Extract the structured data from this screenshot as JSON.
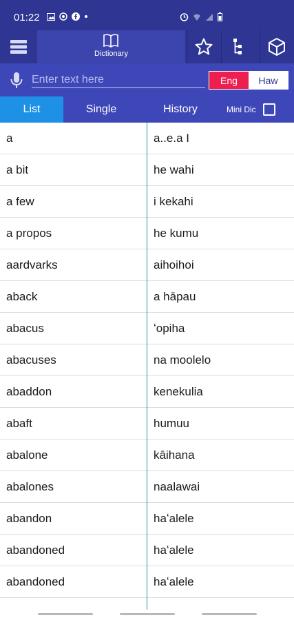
{
  "status_bar": {
    "time": "01:22",
    "icons": [
      "gallery-icon",
      "whatsapp-icon",
      "facebook-icon",
      "dot-icon",
      "alarm-icon",
      "wifi-icon",
      "signal-icon",
      "battery-icon"
    ]
  },
  "toolbar": {
    "dictionary_label": "Dictionary",
    "icons": [
      "menu-icon",
      "book-icon",
      "star-icon",
      "tree-icon",
      "cube-icon"
    ]
  },
  "search": {
    "placeholder": "Enter text here",
    "value": ""
  },
  "language": {
    "eng_label": "Eng",
    "haw_label": "Haw",
    "selected": "Eng"
  },
  "tabs": [
    {
      "label": "List",
      "active": true
    },
    {
      "label": "Single",
      "active": false
    },
    {
      "label": "History",
      "active": false
    }
  ],
  "mini_dic": {
    "label": "Mini Dic",
    "checked": false
  },
  "entries": [
    {
      "en": "a",
      "haw": "a..e.a I"
    },
    {
      "en": "a bit",
      "haw": "he wahi"
    },
    {
      "en": "a few",
      "haw": "i kekahi"
    },
    {
      "en": "a propos",
      "haw": "he kumu"
    },
    {
      "en": "aardvarks",
      "haw": "aihoihoi"
    },
    {
      "en": "aback",
      "haw": "a hāpau"
    },
    {
      "en": "abacus",
      "haw": "ʻopiha"
    },
    {
      "en": "abacuses",
      "haw": "na moolelo"
    },
    {
      "en": "abaddon",
      "haw": "kenekulia"
    },
    {
      "en": "abaft",
      "haw": "humuu"
    },
    {
      "en": "abalone",
      "haw": "kāihana"
    },
    {
      "en": "abalones",
      "haw": "naalawai"
    },
    {
      "en": "abandon",
      "haw": "haʻalele"
    },
    {
      "en": "abandoned",
      "haw": "haʻalele"
    },
    {
      "en": "abandoned",
      "haw": "haʻalele"
    },
    {
      "en": "",
      "haw": ""
    }
  ],
  "colors": {
    "primary": "#2e3592",
    "secondary": "#3e47b8",
    "accent": "#1e90e5",
    "eng_active": "#ee1f4e",
    "divider": "#1a9a93"
  }
}
